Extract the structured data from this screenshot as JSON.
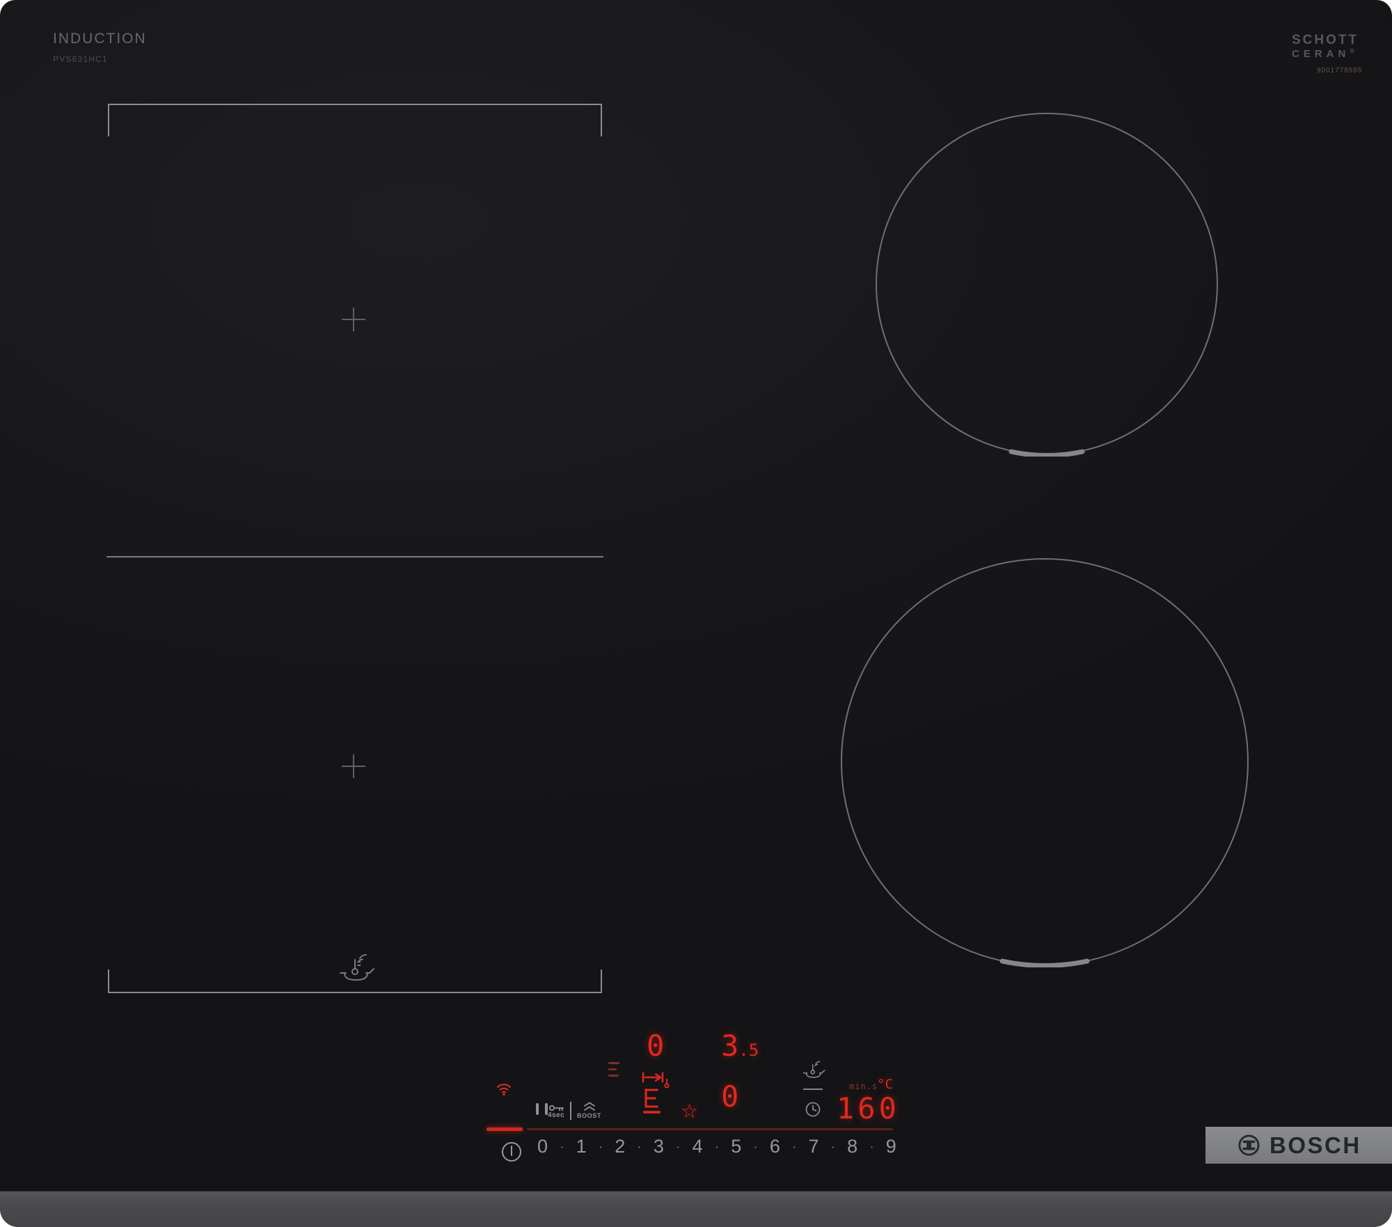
{
  "product": {
    "line": "INDUCTION",
    "model": "PVS631HC1"
  },
  "glass_brand": {
    "name_line1": "SCHOTT",
    "name_line2": "CERAN",
    "registered_mark": "®",
    "serial": "9001778555"
  },
  "brand_plaque": {
    "label": "BOSCH"
  },
  "flex_zone": {
    "plus_mark": "+"
  },
  "led_display": {
    "rear_zone_level": "0",
    "rear_zone_power_int": "3",
    "rear_zone_power_frac": ".5",
    "front_zone_level": "0",
    "favorite_star": "☆",
    "timer_unit_label": "min.s",
    "temperature_unit": "°C",
    "temperature_value": "160"
  },
  "touch_controls": {
    "lock_hold_label": "4sec",
    "boost_label": "BOOST",
    "separator": "·",
    "level_keys": [
      "0",
      "1",
      "2",
      "3",
      "4",
      "5",
      "6",
      "7",
      "8",
      "9"
    ]
  },
  "icons": {
    "wifi": "wifi-signal",
    "pause": "pause-bars",
    "key_lock": "key",
    "boost": "double-chevron-up",
    "power": "power-circle",
    "clock": "timer-clock",
    "pan_sensor": "pan-with-thermometer",
    "move_pan": "move-pan-arrow",
    "status_dashes": "three-dashes",
    "bosch_symbol": "bosch-armature"
  },
  "colors": {
    "led_red": "#e3271c",
    "led_dim_red": "#8a2e28",
    "print_gray": "#8f9193",
    "plaque_gray": "#7f8183",
    "glass_black": "#1a1a1c"
  }
}
